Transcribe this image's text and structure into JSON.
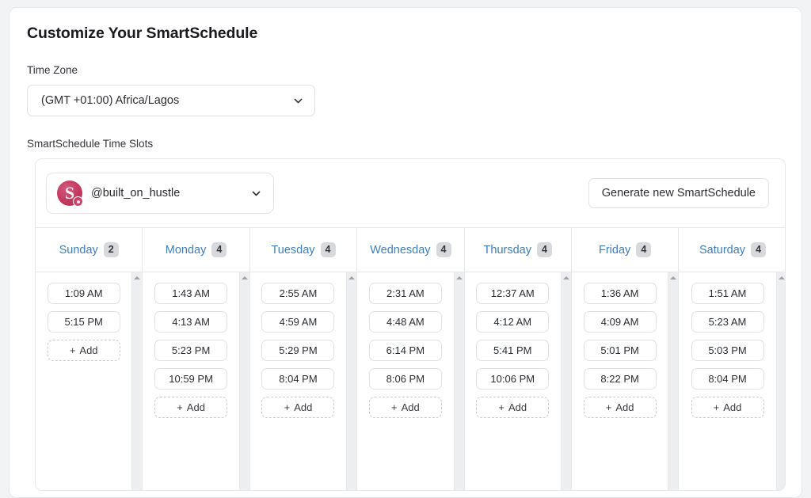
{
  "page_title": "Customize Your SmartSchedule",
  "timezone": {
    "label": "Time Zone",
    "value": "(GMT +01:00) Africa/Lagos",
    "chevron_icon": "chevron-down-icon"
  },
  "slots_section": {
    "label": "SmartSchedule Time Slots",
    "account": {
      "handle": "@built_on_hustle",
      "avatar_icon": "account-avatar",
      "avatar_color": "#c4385f",
      "chevron_icon": "chevron-down-icon"
    },
    "generate_button": "Generate new SmartSchedule",
    "add_label": "Add",
    "add_plus": "+",
    "day_name_color": "#3d7ebb",
    "badge_color": "#d7d9dd",
    "days": [
      {
        "name": "Sunday",
        "count": "2",
        "slots": [
          "1:09 AM",
          "5:15 PM"
        ]
      },
      {
        "name": "Monday",
        "count": "4",
        "slots": [
          "1:43 AM",
          "4:13 AM",
          "5:23 PM",
          "10:59 PM"
        ]
      },
      {
        "name": "Tuesday",
        "count": "4",
        "slots": [
          "2:55 AM",
          "4:59 AM",
          "5:29 PM",
          "8:04 PM"
        ]
      },
      {
        "name": "Wednesday",
        "count": "4",
        "slots": [
          "2:31 AM",
          "4:48 AM",
          "6:14 PM",
          "8:06 PM"
        ]
      },
      {
        "name": "Thursday",
        "count": "4",
        "slots": [
          "12:37 AM",
          "4:12 AM",
          "5:41 PM",
          "10:06 PM"
        ]
      },
      {
        "name": "Friday",
        "count": "4",
        "slots": [
          "1:36 AM",
          "4:09 AM",
          "5:01 PM",
          "8:22 PM"
        ]
      },
      {
        "name": "Saturday",
        "count": "4",
        "slots": [
          "1:51 AM",
          "5:23 AM",
          "5:03 PM",
          "8:04 PM"
        ]
      }
    ]
  }
}
